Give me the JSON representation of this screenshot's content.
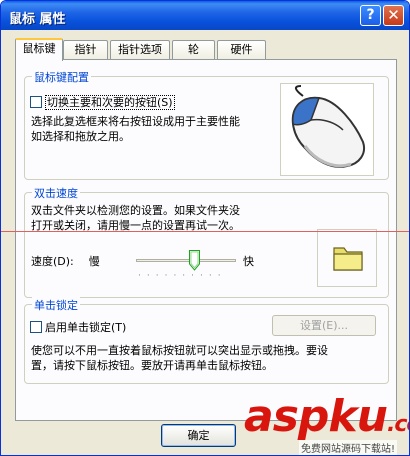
{
  "window": {
    "title": "鼠标 属性",
    "help_glyph": "?",
    "close_glyph": "✕"
  },
  "tabs": [
    {
      "label": "鼠标键",
      "active": true
    },
    {
      "label": "指针",
      "active": false
    },
    {
      "label": "指针选项",
      "active": false
    },
    {
      "label": "轮",
      "active": false
    },
    {
      "label": "硬件",
      "active": false
    }
  ],
  "button_config": {
    "title": "鼠标键配置",
    "checkbox_label": "切换主要和次要的按钮(S)",
    "checked": false,
    "description": "选择此复选框来将右按钮设成用于主要性能\n如选择和拖放之用。",
    "icon": "mouse-icon"
  },
  "double_click": {
    "title": "双击速度",
    "description": "双击文件夹以检测您的设置。如果文件夹没\n打开或关闭，请用慢一点的设置再试一次。",
    "speed_label": "速度(D):",
    "slow_label": "慢",
    "fast_label": "快",
    "speed_level": 0.6,
    "icon": "folder-icon"
  },
  "click_lock": {
    "title": "单击锁定",
    "checkbox_label": "启用单击锁定(T)",
    "checked": false,
    "settings_label": "设置(E)...",
    "description": "使您可以不用一直按着鼠标按钮就可以突出显示或拖拽。要设\n置，请按下鼠标按钮。要放开请再单击鼠标按钮。"
  },
  "footer": {
    "ok_label": "确定"
  },
  "watermark": {
    "brand": "aspku",
    "brand_suffix": ".com",
    "tagline": "免费网站源码下载站!"
  },
  "colors": {
    "accent": "#0046d5",
    "titlebar": "#0852dc",
    "watermark": "#d8160d"
  }
}
